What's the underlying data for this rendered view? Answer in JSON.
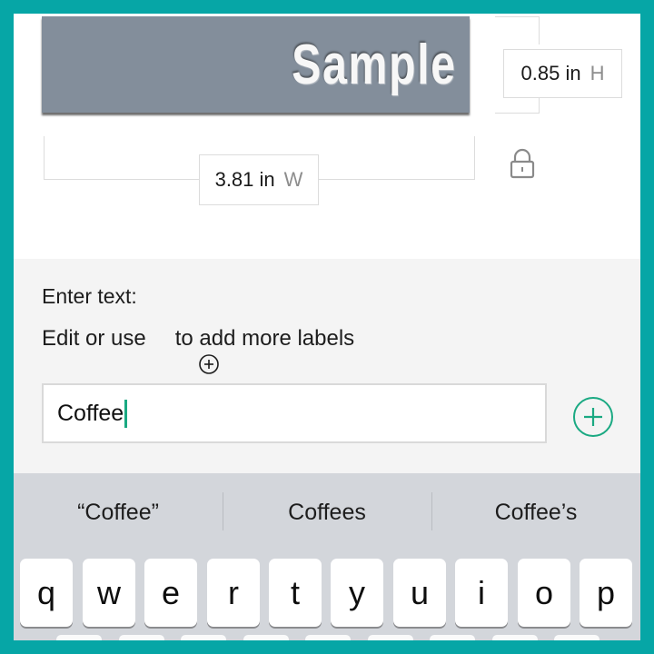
{
  "preview": {
    "label_text": "Sample",
    "label_color": "#838e9b",
    "height_value": "0.85 in",
    "height_axis": "H",
    "width_value": "3.81 in",
    "width_axis": "W",
    "lock_icon": "lock-icon"
  },
  "entry": {
    "title": "Enter text:",
    "help_before": "Edit or use",
    "help_icon": "circle-plus-icon",
    "help_after": "to add more labels",
    "field_value": "Coffee",
    "add_button_icon": "circle-plus-icon",
    "accent_color": "#1aa982"
  },
  "keyboard": {
    "suggestions": [
      "“Coffee”",
      "Coffees",
      "Coffee’s"
    ],
    "row1": [
      "q",
      "w",
      "e",
      "r",
      "t",
      "y",
      "u",
      "i",
      "o",
      "p"
    ]
  },
  "frame_color": "#06a6a6"
}
